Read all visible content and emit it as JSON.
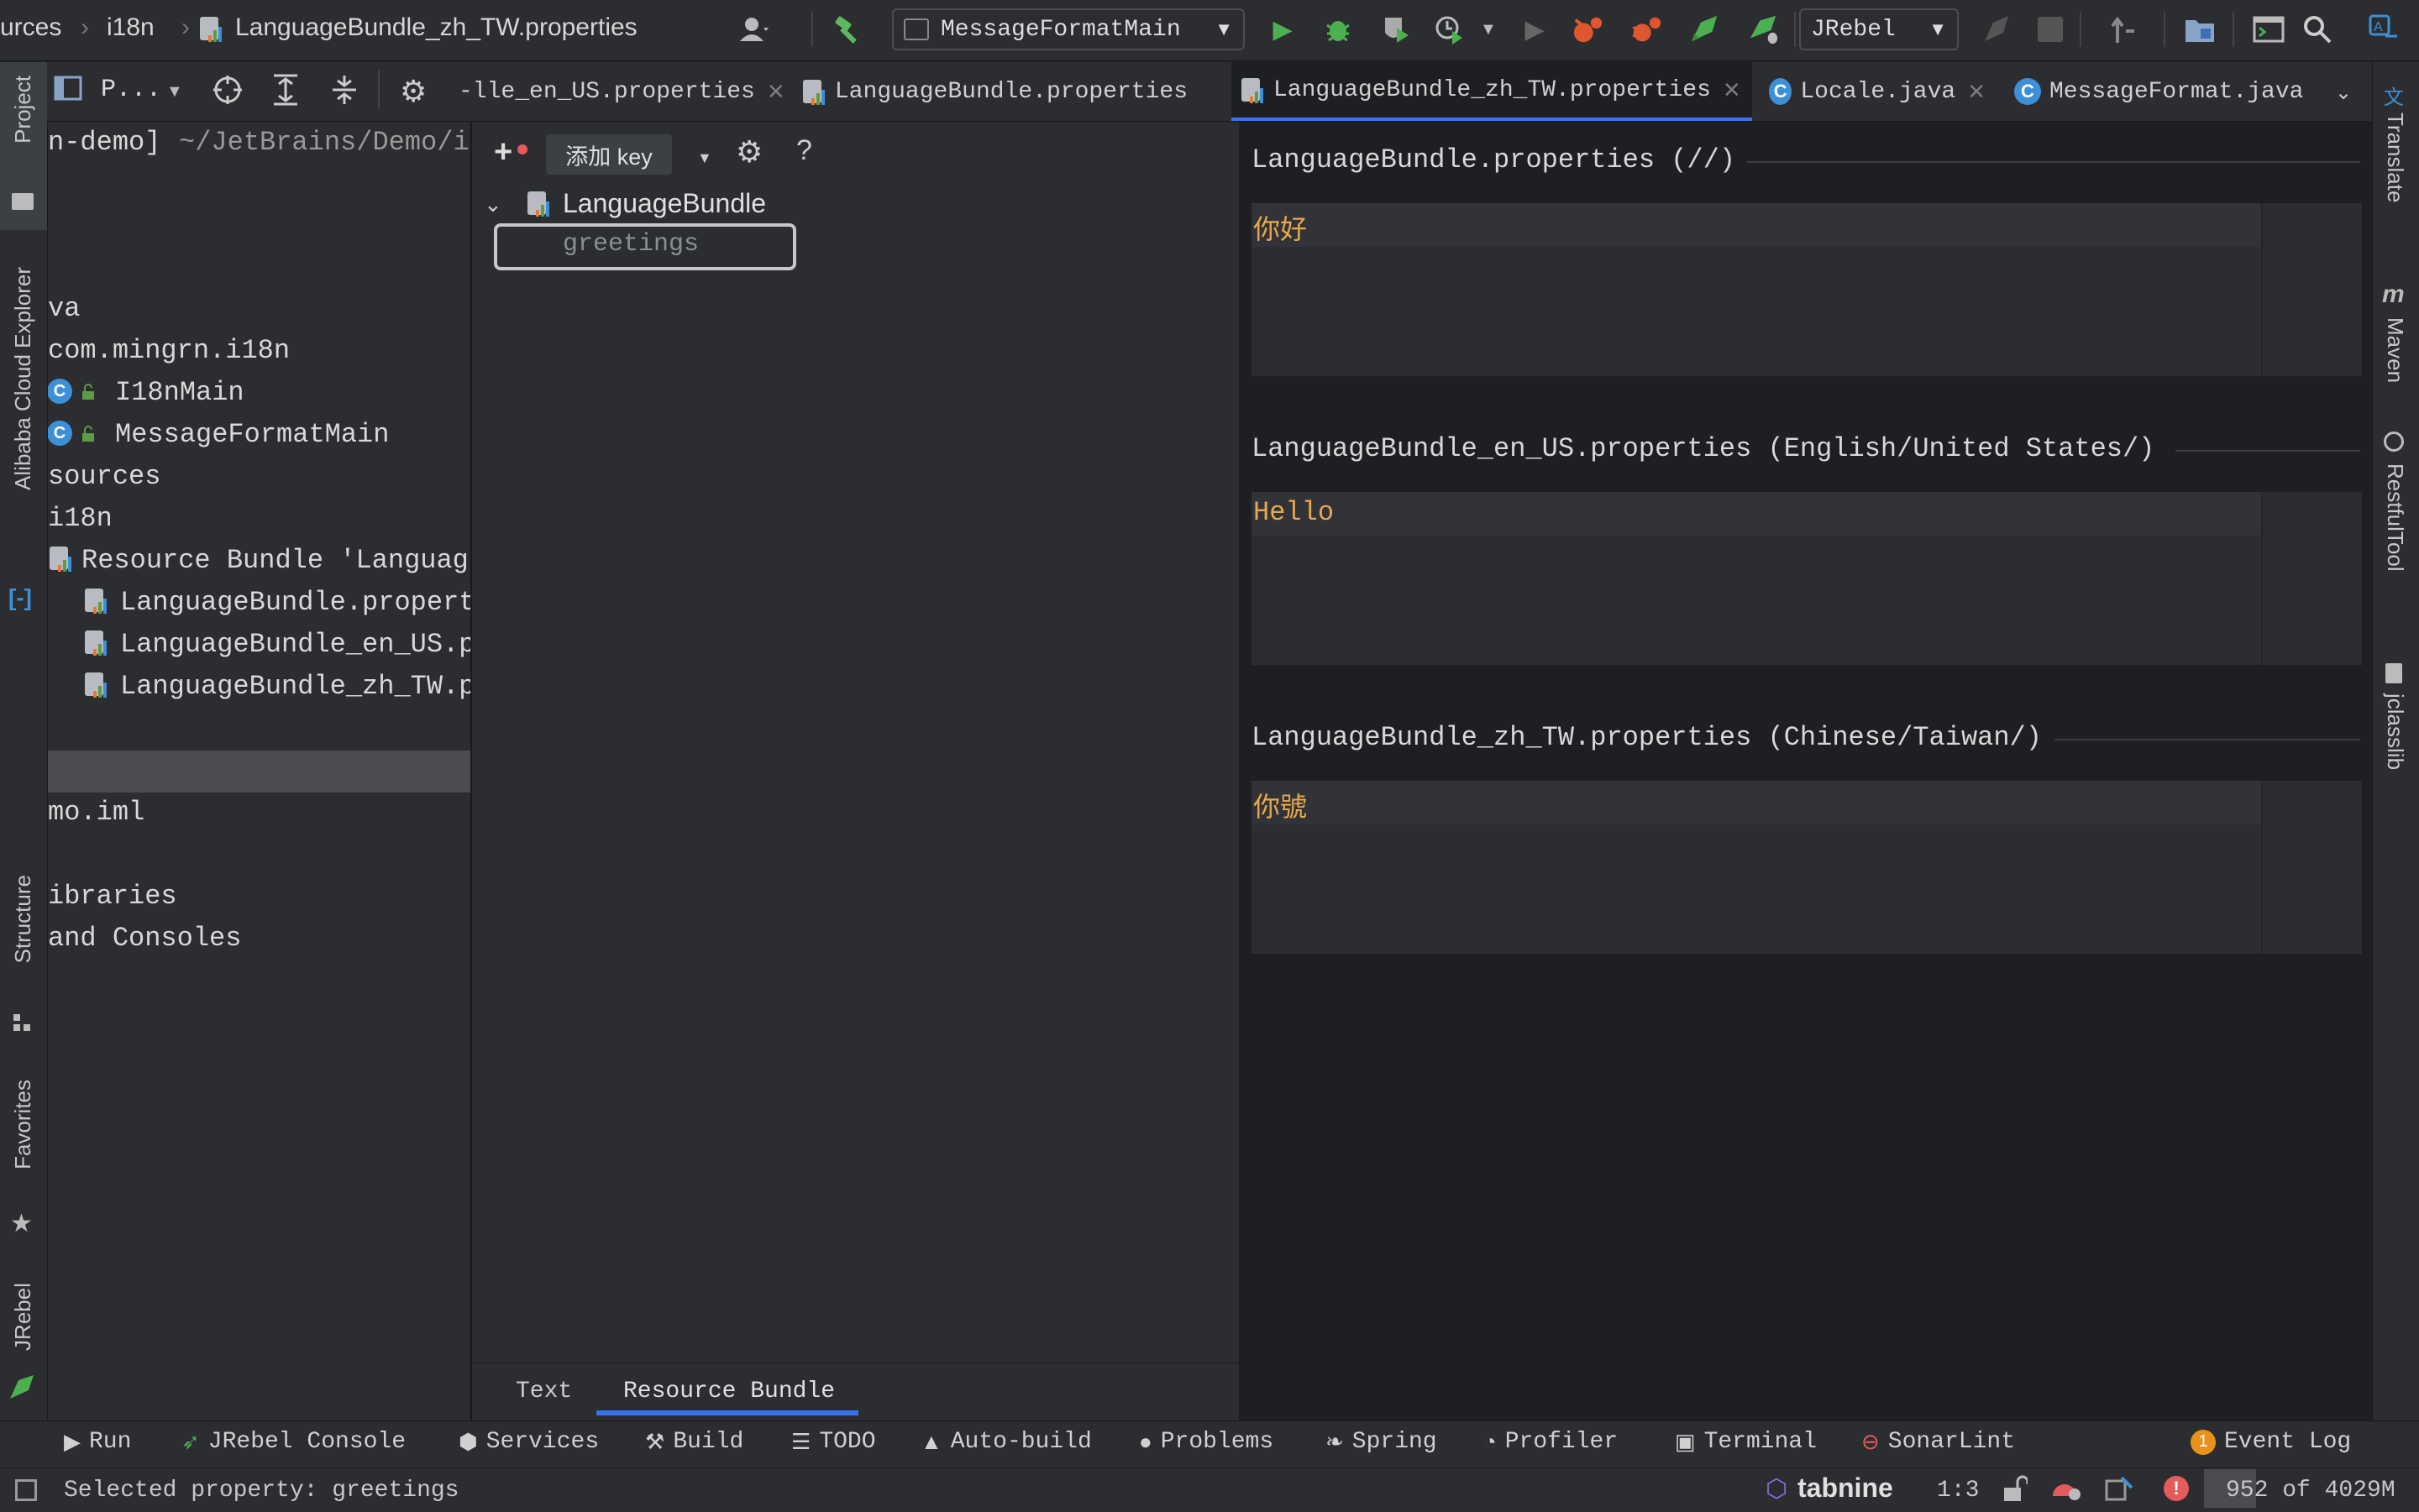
{
  "titlebar": {
    "breadcrumbs": [
      "urces",
      "i18n",
      "LanguageBundle_zh_TW.properties"
    ],
    "run_config": "MessageFormatMain",
    "jrebel_combo": "JRebel"
  },
  "editor_tabs": [
    {
      "label": "-lle_en_US.properties",
      "icon": "properties-file-icon"
    },
    {
      "label": "LanguageBundle.properties",
      "icon": "properties-file-icon"
    },
    {
      "label": "LanguageBundle_zh_TW.properties",
      "icon": "properties-file-icon",
      "active": true
    },
    {
      "label": "Locale.java",
      "icon": "java-class-icon"
    },
    {
      "label": "MessageFormat.java",
      "icon": "java-class-icon"
    }
  ],
  "left_strip": {
    "project": "Project",
    "alibaba": "Alibaba Cloud Explorer",
    "structure": "Structure",
    "favorites": "Favorites",
    "jrebel": "JRebel"
  },
  "right_strip": {
    "translate": "Translate",
    "maven": "Maven",
    "restful": "RestfulTool",
    "jclasslib": "jclasslib"
  },
  "project_panel": {
    "toolbar_label": "P...",
    "root_name": "n-demo]",
    "root_path": "~/JetBrains/Demo/i",
    "tree": [
      {
        "text": "va"
      },
      {
        "text": "com.mingrn.i18n"
      },
      {
        "text": "I18nMain",
        "icon": "java-class-icon"
      },
      {
        "text": "MessageFormatMain",
        "icon": "java-class-icon"
      },
      {
        "text": "sources"
      },
      {
        "text": "i18n"
      },
      {
        "text": "Resource Bundle 'Languag",
        "icon": "resource-bundle-icon"
      },
      {
        "text": "LanguageBundle.propert",
        "icon": "properties-file-icon"
      },
      {
        "text": "LanguageBundle_en_US.p",
        "icon": "properties-file-icon"
      },
      {
        "text": "LanguageBundle_zh_TW.p",
        "icon": "properties-file-icon"
      },
      {
        "text": "mo.iml"
      },
      {
        "text": "ibraries"
      },
      {
        "text": "and Consoles"
      }
    ]
  },
  "rb_panel": {
    "tooltip": "添加 key",
    "bundle_name": "LanguageBundle",
    "selected_key": "greetings"
  },
  "sections": [
    {
      "header": "LanguageBundle.properties (//)",
      "value": "你好"
    },
    {
      "header": "LanguageBundle_en_US.properties (English/United States/)",
      "value": "Hello"
    },
    {
      "header": "LanguageBundle_zh_TW.properties (Chinese/Taiwan/)",
      "value": "你號"
    }
  ],
  "bottom_tabs": {
    "text": "Text",
    "resource_bundle": "Resource Bundle"
  },
  "tool_windows": {
    "run": "Run",
    "jrebel_console": "JRebel Console",
    "services": "Services",
    "build": "Build",
    "todo": "TODO",
    "auto_build": "Auto-build",
    "problems": "Problems",
    "spring": "Spring",
    "profiler": "Profiler",
    "terminal": "Terminal",
    "sonarlint": "SonarLint",
    "event_log": "Event Log",
    "event_log_count": "1"
  },
  "status_bar": {
    "message": "Selected property: greetings",
    "tabnine": "tabnine",
    "position": "1:3",
    "memory": "952 of 4029M"
  },
  "colors": {
    "accent": "#3574f0",
    "value_text": "#e8a84c",
    "run_green": "#4caf50",
    "error_red": "#e55b5b"
  }
}
